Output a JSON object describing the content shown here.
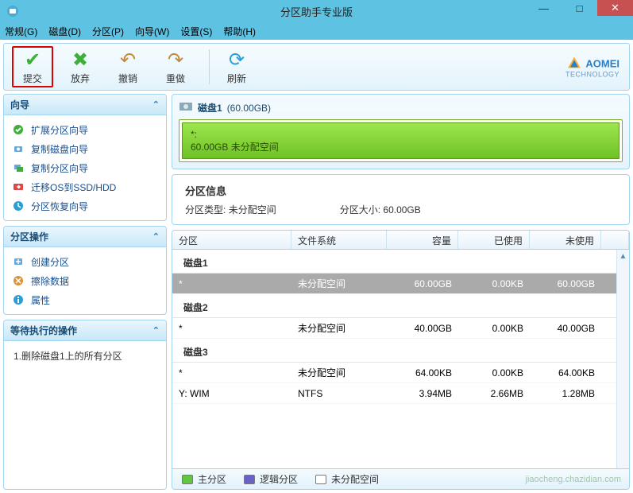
{
  "window": {
    "title": "分区助手专业版"
  },
  "menu": [
    "常规(G)",
    "磁盘(D)",
    "分区(P)",
    "向导(W)",
    "设置(S)",
    "帮助(H)"
  ],
  "toolbar": {
    "commit": "提交",
    "discard": "放弃",
    "undo": "撤销",
    "redo": "重做",
    "refresh": "刷新"
  },
  "logo": {
    "name": "AOMEI",
    "sub": "TECHNOLOGY"
  },
  "sidebar": {
    "wizard": {
      "title": "向导",
      "items": [
        "扩展分区向导",
        "复制磁盘向导",
        "复制分区向导",
        "迁移OS到SSD/HDD",
        "分区恢复向导"
      ]
    },
    "ops": {
      "title": "分区操作",
      "items": [
        "创建分区",
        "擦除数据",
        "属性"
      ]
    },
    "pending": {
      "title": "等待执行的操作",
      "text": "1.删除磁盘1上的所有分区"
    }
  },
  "disk": {
    "header_name": "磁盘1",
    "header_size": "(60.00GB)",
    "seg_label": "*:",
    "seg_desc": "60.00GB 未分配空间"
  },
  "info": {
    "title": "分区信息",
    "type_lbl": "分区类型:",
    "type_val": "未分配空间",
    "size_lbl": "分区大小:",
    "size_val": "60.00GB"
  },
  "grid": {
    "cols": [
      "分区",
      "文件系统",
      "容量",
      "已使用",
      "未使用"
    ],
    "groups": [
      {
        "name": "磁盘1",
        "rows": [
          {
            "part": "*",
            "fs": "未分配空间",
            "cap": "60.00GB",
            "used": "0.00KB",
            "free": "60.00GB",
            "selected": true
          }
        ]
      },
      {
        "name": "磁盘2",
        "rows": [
          {
            "part": "*",
            "fs": "未分配空间",
            "cap": "40.00GB",
            "used": "0.00KB",
            "free": "40.00GB",
            "selected": false
          }
        ]
      },
      {
        "name": "磁盘3",
        "rows": [
          {
            "part": "*",
            "fs": "未分配空间",
            "cap": "64.00KB",
            "used": "0.00KB",
            "free": "64.00KB",
            "selected": false
          },
          {
            "part": "Y: WIM",
            "fs": "NTFS",
            "cap": "3.94MB",
            "used": "2.66MB",
            "free": "1.28MB",
            "selected": false
          }
        ]
      }
    ]
  },
  "legend": {
    "primary": "主分区",
    "logical": "逻辑分区",
    "unalloc": "未分配空间"
  },
  "watermark": "jiaocheng.chazidian.com"
}
